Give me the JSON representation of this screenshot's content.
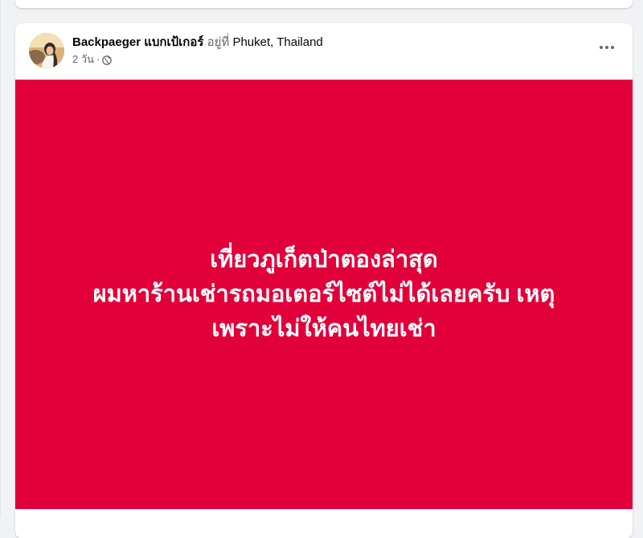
{
  "post": {
    "author": "Backpaeger แบกเป้เกอร์",
    "at_text": "อยู่ที่",
    "location": "Phuket, Thailand",
    "time": "2 วัน",
    "separator": "·",
    "privacy_icon": "globe-icon",
    "more_icon": "more-horizontal-icon",
    "image": {
      "background_color": "#e2003a",
      "text_color": "#ffffff",
      "lines": [
        "เที่ยวภูเก็ตป่าตองล่าสุด",
        "ผมหาร้านเช่ารถมอเตอร์ไซต์ไม่ได้เลยครับ เหตุ",
        "เพราะไม่ให้คนไทยเช่า"
      ]
    }
  }
}
